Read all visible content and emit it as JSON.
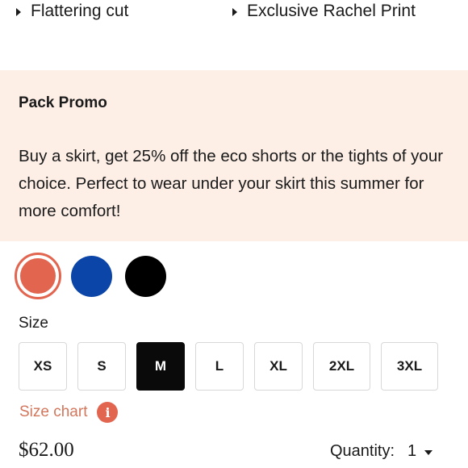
{
  "features": [
    {
      "label": "Flattering cut",
      "icon": "bullet-triangle-icon"
    },
    {
      "label": "Exclusive Rachel Print",
      "icon": "bullet-triangle-icon"
    }
  ],
  "promo": {
    "title": "Pack Promo",
    "text": "Buy a skirt, get 25% off the eco shorts or the tights of your choice. Perfect to wear under your skirt this summer for more comfort!",
    "background": "#fdeee6"
  },
  "colors": {
    "swatches": [
      "#e26550",
      "#0b45a8",
      "#000000"
    ],
    "selected_index": 0
  },
  "size": {
    "label": "Size",
    "options": [
      "XS",
      "S",
      "M",
      "L",
      "XL",
      "2XL",
      "3XL"
    ],
    "selected": "M"
  },
  "size_chart": {
    "label": "Size chart",
    "info_glyph": "i",
    "accent": "#e26550"
  },
  "price": "$62.00",
  "quantity": {
    "label": "Quantity:",
    "value": "1"
  }
}
